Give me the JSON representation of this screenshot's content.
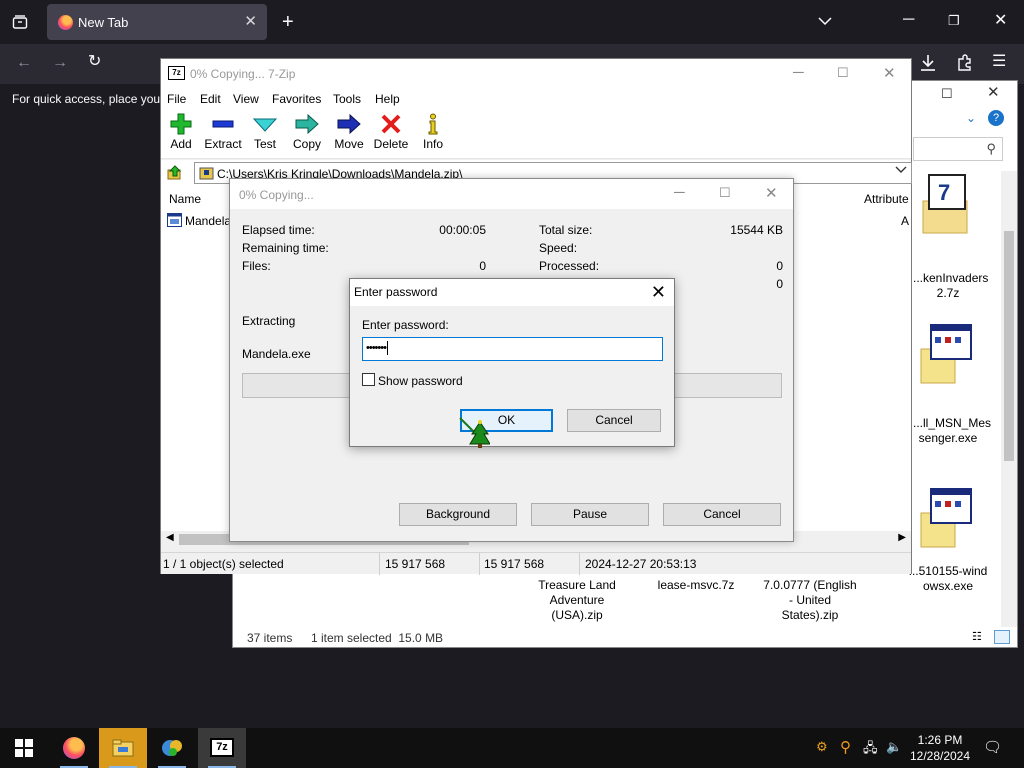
{
  "browser": {
    "tab_title": "New Tab",
    "new_tab_label": "+",
    "bookmark_message": "For quick access, place your"
  },
  "explorer": {
    "status_items": "37 items",
    "status_selected": "1 item selected  15.0 MB",
    "files": [
      {
        "name": "...kenInvaders\n2.7z"
      },
      {
        "name": "...ll_MSN_Mes\nsenger.exe"
      },
      {
        "name": "...510155-wind\nowsx.exe"
      },
      {
        "name": "Treasure Land\nAdventure\n(USA).zip"
      },
      {
        "name": "lease-msvc.7z"
      },
      {
        "name": "7.0.0777 (English\n- United\nStates).zip"
      }
    ]
  },
  "zip": {
    "title": "0% Copying... 7-Zip",
    "menu": [
      "File",
      "Edit",
      "View",
      "Favorites",
      "Tools",
      "Help"
    ],
    "toolbar": [
      "Add",
      "Extract",
      "Test",
      "Copy",
      "Move",
      "Delete",
      "Info"
    ],
    "address": "C:\\Users\\Kris Kringle\\Downloads\\Mandela.zip\\",
    "columns": {
      "name": "Name",
      "attributes": "Attribute"
    },
    "row_name": "Mandela",
    "row_attr": "A",
    "status": {
      "selected": "1 / 1 object(s) selected",
      "size": "15 917 568",
      "packed": "15 917 568",
      "modified": "2024-12-27 20:53:13"
    }
  },
  "progress": {
    "title": "0% Copying...",
    "elapsed_label": "Elapsed time:",
    "elapsed_value": "00:00:05",
    "remaining_label": "Remaining time:",
    "files_label": "Files:",
    "files_value": "0",
    "total_label": "Total size:",
    "total_value": "15544 KB",
    "speed_label": "Speed:",
    "processed_label": "Processed:",
    "processed_value": "0",
    "extra_value": "0",
    "action": "Extracting",
    "file": "Mandela.exe",
    "percent": 0,
    "buttons": {
      "background": "Background",
      "pause": "Pause",
      "cancel": "Cancel"
    }
  },
  "password_dialog": {
    "title": "Enter password",
    "label": "Enter password:",
    "value": "•••••••",
    "show_password": "Show password",
    "ok": "OK",
    "cancel": "Cancel"
  },
  "taskbar": {
    "time": "1:26 PM",
    "date": "12/28/2024"
  },
  "colors": {
    "accent": "#0078d7",
    "firefox_dark": "#1c1b22"
  }
}
